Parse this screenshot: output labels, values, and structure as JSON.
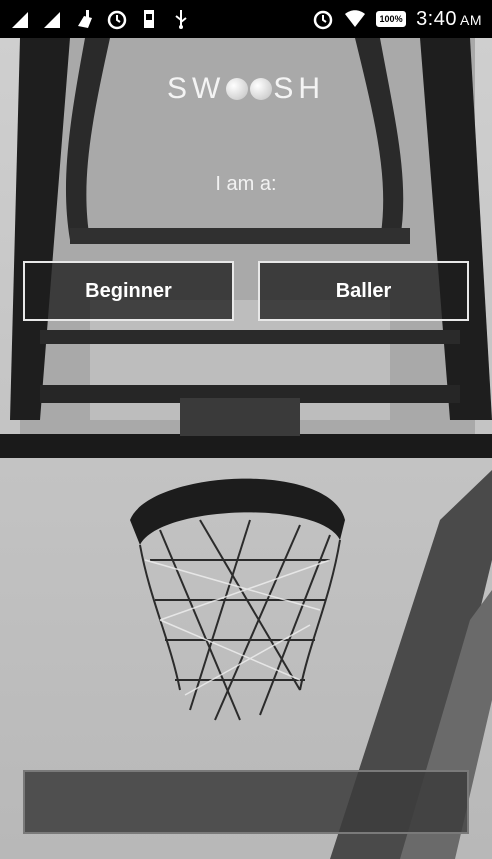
{
  "status_bar": {
    "time": "3:40",
    "ampm": "AM",
    "battery": "100%",
    "icons_left": [
      "signal-1-icon",
      "signal-2-icon",
      "cleaner-icon",
      "alarm-icon",
      "sd-card-icon",
      "usb-icon"
    ],
    "icons_right": [
      "alarm-icon",
      "wifi-icon",
      "battery-icon"
    ]
  },
  "logo": {
    "prefix": "SW",
    "suffix": "SH"
  },
  "prompt": "I am a:",
  "options": {
    "beginner": "Beginner",
    "baller": "Baller"
  },
  "bottom_button": {
    "label": ""
  }
}
